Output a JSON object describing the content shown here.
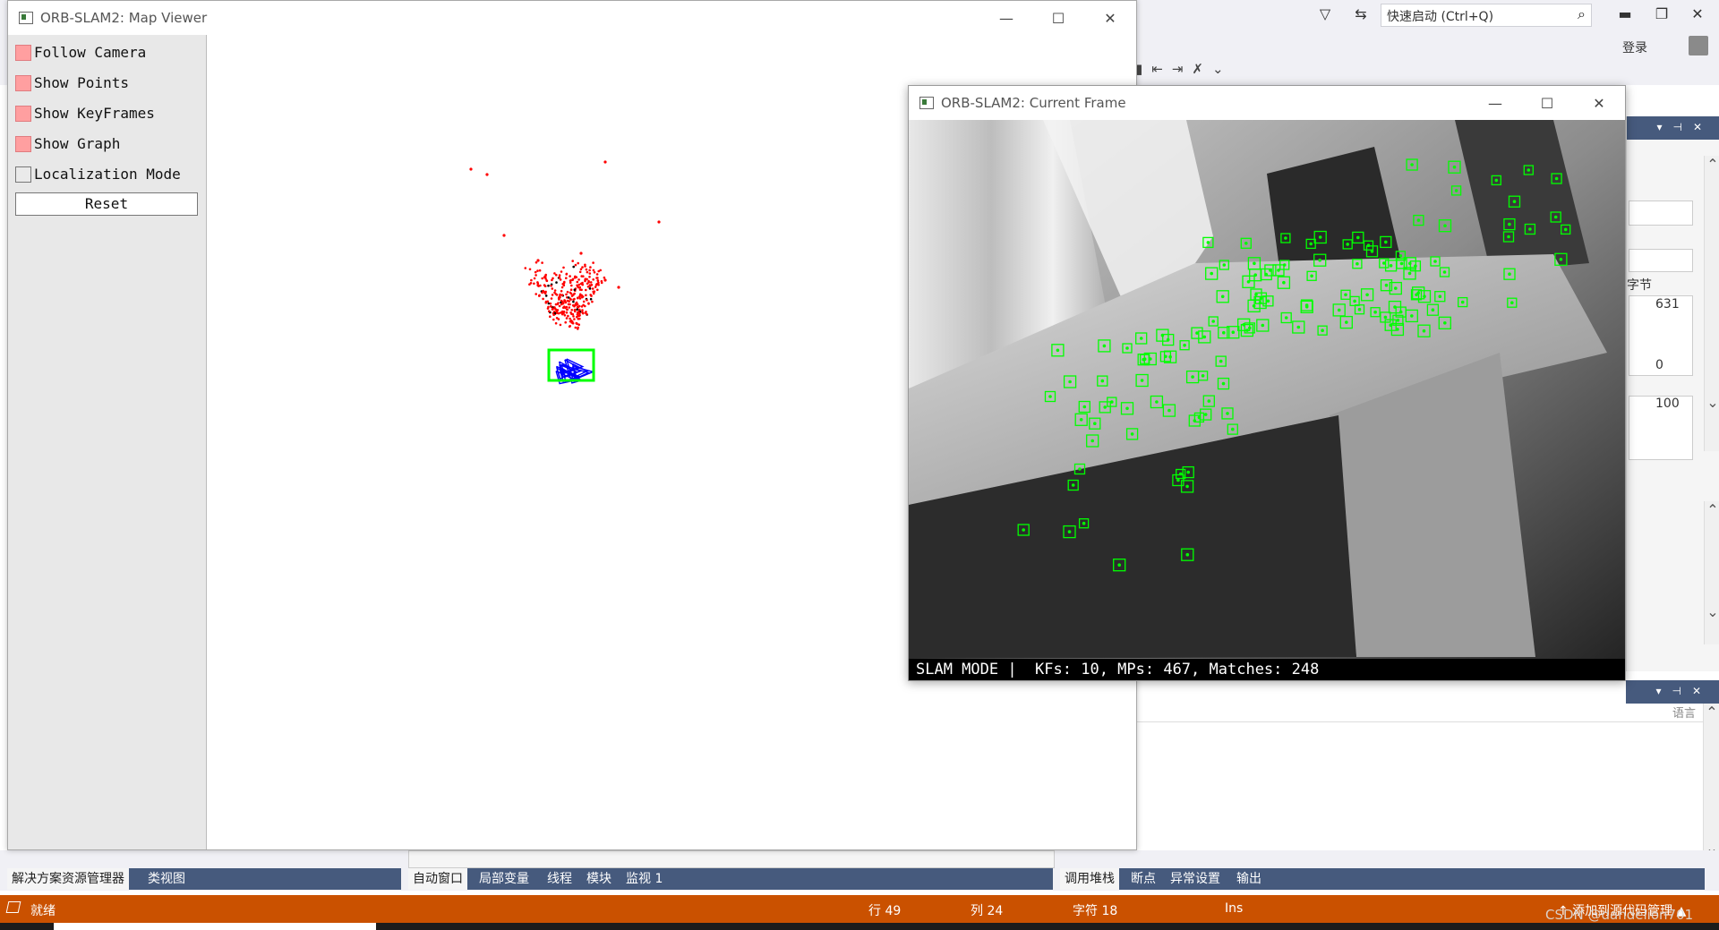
{
  "vs": {
    "search_placeholder": "快速启动 (Ctrl+Q)",
    "login": "登录",
    "right_pane": {
      "field_label": "字节",
      "value1": "631",
      "value2": "0",
      "value3": "100",
      "lang": "语言"
    },
    "bottom_tabs_left": [
      "解决方案资源管理器",
      "类视图"
    ],
    "bottom_tabs_mid": [
      "自动窗口",
      "局部变量",
      "线程",
      "模块",
      "监视 1"
    ],
    "bottom_tabs_right": [
      "调用堆栈",
      "断点",
      "异常设置",
      "输出"
    ],
    "status": {
      "ready": "就绪",
      "line": "行 49",
      "col": "列 24",
      "char": "字符 18",
      "ins": "Ins",
      "add_source": "↑ 添加到源代码管理 ▲"
    },
    "watermark": "CSDN @dandelion701"
  },
  "map_viewer": {
    "title": "ORB-SLAM2: Map Viewer",
    "options": [
      {
        "label": "Follow Camera",
        "checked": true
      },
      {
        "label": "Show Points",
        "checked": true
      },
      {
        "label": "Show KeyFrames",
        "checked": true
      },
      {
        "label": "Show Graph",
        "checked": true
      },
      {
        "label": "Localization Mode",
        "checked": false
      }
    ],
    "reset_label": "Reset"
  },
  "current_frame": {
    "title": "ORB-SLAM2: Current Frame",
    "status_text": "SLAM MODE |  KFs: 10, MPs: 467, Matches: 248"
  },
  "colors": {
    "status_bar": "#ca5100",
    "vs_tabbar": "#465a7d",
    "map_point": "#ff0000",
    "keyframe": "#0000ff",
    "current_camera": "#00ff00",
    "feature": "#00ff00"
  }
}
